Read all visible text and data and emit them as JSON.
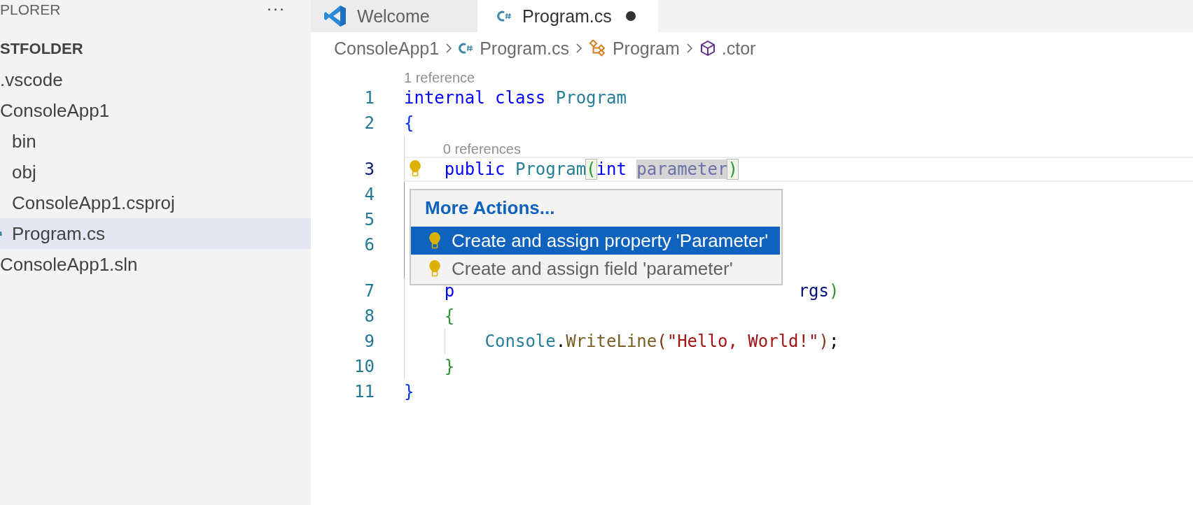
{
  "sidebar": {
    "title": "PLORER",
    "more": "···",
    "folder": "STFOLDER",
    "items": [
      {
        "label": ".vscode",
        "selected": false
      },
      {
        "label": "ConsoleApp1",
        "selected": false,
        "children": [
          {
            "label": "bin",
            "selected": false
          },
          {
            "label": "obj",
            "selected": false
          },
          {
            "label": "ConsoleApp1.csproj",
            "selected": false
          },
          {
            "label": "Program.cs",
            "selected": true,
            "kind": "csharp"
          }
        ]
      },
      {
        "label": "ConsoleApp1.sln",
        "selected": false
      }
    ]
  },
  "tabs": [
    {
      "label": "Welcome",
      "selected": false,
      "kind": "welcome",
      "dirty": false
    },
    {
      "label": "Program.cs",
      "selected": true,
      "kind": "csharp",
      "dirty": true
    }
  ],
  "breadcrumb": [
    {
      "label": "ConsoleApp1",
      "kind": "folder"
    },
    {
      "label": "Program.cs",
      "kind": "csharp"
    },
    {
      "label": "Program",
      "kind": "class"
    },
    {
      "label": ".ctor",
      "kind": "method"
    }
  ],
  "lines": [
    {
      "kind": "lens",
      "text": "1 reference"
    },
    {
      "kind": "code",
      "number": "1",
      "current": false,
      "lightbulb": false,
      "tokens": [
        {
          "text": "internal ",
          "kind": "keyword"
        },
        {
          "text": "class ",
          "kind": "keyword"
        },
        {
          "text": "Program",
          "kind": "type"
        }
      ]
    },
    {
      "kind": "code",
      "number": "2",
      "current": false,
      "lightbulb": false,
      "tokens": [
        {
          "text": "{",
          "kind": "brace1"
        }
      ]
    },
    {
      "kind": "lens",
      "text": "0 references"
    },
    {
      "kind": "code",
      "number": "3",
      "current": true,
      "lightbulb": true,
      "tokens": [
        {
          "text": "    public ",
          "kind": "keyword"
        },
        {
          "text": "Program",
          "kind": "type"
        },
        {
          "text": "(",
          "kind": "bracket-match"
        },
        {
          "text": "int ",
          "kind": "keyword"
        },
        {
          "text": "parameter",
          "kind": "param-highlight"
        },
        {
          "text": ")",
          "kind": "bracket-match"
        }
      ]
    },
    {
      "kind": "code",
      "number": "4",
      "current": false,
      "lightbulb": false
    },
    {
      "kind": "code",
      "number": "5",
      "current": false,
      "lightbulb": false
    },
    {
      "kind": "code",
      "number": "6",
      "current": false,
      "lightbulb": false
    },
    {
      "kind": "gap"
    },
    {
      "kind": "code",
      "number": "7",
      "current": false,
      "lightbulb": false,
      "tokens": [
        {
          "text": "    p",
          "kind": "keyword"
        },
        {
          "text": "                                  rgs",
          "kind": "param"
        },
        {
          "text": ")",
          "kind": "brace2"
        }
      ]
    },
    {
      "kind": "code",
      "number": "8",
      "current": false,
      "lightbulb": false,
      "tokens": [
        {
          "text": "    {",
          "kind": "brace2"
        }
      ]
    },
    {
      "kind": "code",
      "number": "9",
      "current": false,
      "lightbulb": false,
      "tokens": [
        {
          "text": "        Console",
          "kind": "type"
        },
        {
          "text": ".",
          "kind": "plain"
        },
        {
          "text": "WriteLine",
          "kind": "method"
        },
        {
          "text": "(",
          "kind": "brace3"
        },
        {
          "text": "\"Hello, World!\"",
          "kind": "string"
        },
        {
          "text": ")",
          "kind": "brace3"
        },
        {
          "text": ";",
          "kind": "plain"
        }
      ]
    },
    {
      "kind": "code",
      "number": "10",
      "current": false,
      "lightbulb": false,
      "tokens": [
        {
          "text": "    }",
          "kind": "brace2"
        }
      ]
    },
    {
      "kind": "code",
      "number": "11",
      "current": false,
      "lightbulb": false,
      "tokens": [
        {
          "text": "}",
          "kind": "brace1"
        }
      ]
    }
  ],
  "actions_popup": {
    "header": "More Actions...",
    "items": [
      {
        "label": "Create and assign property 'Parameter'",
        "selected": true
      },
      {
        "label": "Create and assign field 'parameter'",
        "selected": false
      }
    ]
  }
}
